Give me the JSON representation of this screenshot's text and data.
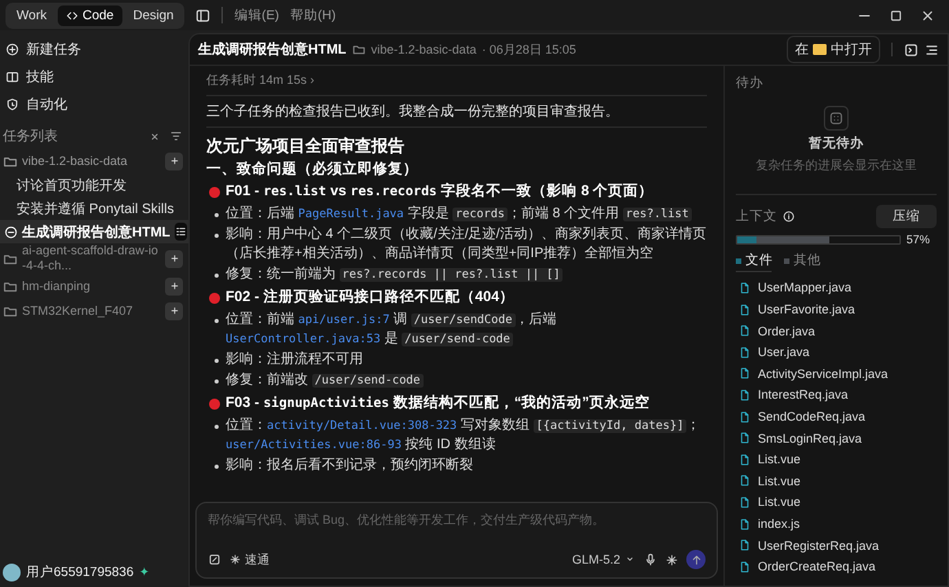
{
  "topbar": {
    "modes": [
      {
        "label": "Work",
        "kind": "plain",
        "selected": false
      },
      {
        "label": "Code",
        "kind": "code",
        "selected": true
      },
      {
        "label": "Design",
        "kind": "plain",
        "selected": false
      }
    ],
    "menus": [
      "编辑(E)",
      "帮助(H)"
    ]
  },
  "sidebar": {
    "actions": [
      {
        "label": "新建任务",
        "kind": "new"
      },
      {
        "label": "技能",
        "kind": "skills"
      },
      {
        "label": "自动化",
        "kind": "auto"
      }
    ],
    "task_list_title": "任务列表",
    "projects": [
      {
        "name": "vibe-1.2-basic-data",
        "expanded": true,
        "children": [
          {
            "label": "讨论首页功能开发",
            "selected": false
          },
          {
            "label": "安装并遵循 Ponytail Skills",
            "selected": false
          },
          {
            "label": "生成调研报告创意HTML",
            "selected": true
          }
        ]
      },
      {
        "name": "ai-agent-scaffold-draw-io-4-4-ch...",
        "expanded": false
      },
      {
        "name": "hm-dianping",
        "expanded": false
      },
      {
        "name": "STM32Kernel_F407",
        "expanded": false
      }
    ],
    "user": {
      "name": "用户65591795836",
      "badge": "✦"
    }
  },
  "chat": {
    "title": "生成调研报告创意HTML",
    "project": "vibe-1.2-basic-data",
    "date": "· 06月28日 15:05",
    "duration": "任务耗时 14m 15s",
    "duration_caret": "›",
    "message": "三个子任务的检查报告已收到。我整合成一份完整的项目审查报告。",
    "report_title": "次元广场项目全面审查报告",
    "sections": [
      {
        "heading": "一、致命问题（必须立即修复）",
        "issues": [
          {
            "title": [
              {
                "kind": "text",
                "text": "F01 - "
              },
              {
                "kind": "code",
                "text": "res.list"
              },
              {
                "kind": "text",
                "text": " vs "
              },
              {
                "kind": "code",
                "text": "res.records"
              },
              {
                "kind": "text",
                "text": " 字段名不一致（影响 8 个页面）"
              }
            ],
            "bullets": [
              [
                {
                  "kind": "text",
                  "text": "位置：后端 "
                },
                {
                  "kind": "link",
                  "text": "PageResult.java"
                },
                {
                  "kind": "text",
                  "text": " 字段是 "
                },
                {
                  "kind": "chip",
                  "text": "records"
                },
                {
                  "kind": "text",
                  "text": "；前端 8 个文件用 "
                },
                {
                  "kind": "chip",
                  "text": "res?.list"
                }
              ],
              [
                {
                  "kind": "text",
                  "text": "影响：用户中心 4 个二级页（收藏/关注/足迹/活动）、商家列表页、商家详情页（店长推荐+相关活动）、商品详情页（同类型+同IP推荐）全部恒为空"
                }
              ],
              [
                {
                  "kind": "text",
                  "text": "修复：统一前端为 "
                },
                {
                  "kind": "chip",
                  "text": "res?.records || res?.list || []"
                }
              ]
            ]
          },
          {
            "title": [
              {
                "kind": "text",
                "text": "F02 - 注册页验证码接口路径不匹配（404）"
              }
            ],
            "bullets": [
              [
                {
                  "kind": "text",
                  "text": "位置：前端 "
                },
                {
                  "kind": "link",
                  "text": "api/user.js:7"
                },
                {
                  "kind": "text",
                  "text": " 调 "
                },
                {
                  "kind": "chip",
                  "text": "/user/sendCode"
                },
                {
                  "kind": "text",
                  "text": "，后端 "
                },
                {
                  "kind": "link",
                  "text": "UserController.java:53"
                },
                {
                  "kind": "text",
                  "text": " 是 "
                },
                {
                  "kind": "chip",
                  "text": "/user/send-code"
                }
              ],
              [
                {
                  "kind": "text",
                  "text": "影响：注册流程不可用"
                }
              ],
              [
                {
                  "kind": "text",
                  "text": "修复：前端改 "
                },
                {
                  "kind": "chip",
                  "text": "/user/send-code"
                }
              ]
            ]
          },
          {
            "title": [
              {
                "kind": "text",
                "text": "F03 - "
              },
              {
                "kind": "code",
                "text": "signupActivities"
              },
              {
                "kind": "text",
                "text": " 数据结构不匹配，“我的活动”页永远空"
              }
            ],
            "bullets": [
              [
                {
                  "kind": "text",
                  "text": "位置："
                },
                {
                  "kind": "link",
                  "text": "activity/Detail.vue:308-323"
                },
                {
                  "kind": "text",
                  "text": " 写对象数组 "
                },
                {
                  "kind": "chip",
                  "text": "[{activityId, dates}]"
                },
                {
                  "kind": "text",
                  "text": "；"
                },
                {
                  "kind": "link",
                  "text": "user/Activities.vue:86-93"
                },
                {
                  "kind": "text",
                  "text": " 按纯 ID 数组读"
                }
              ],
              [
                {
                  "kind": "text",
                  "text": "影响：报名后看不到记录，预约闭环断裂"
                }
              ]
            ]
          }
        ]
      }
    ],
    "input": {
      "placeholder": "帮你编写代码、调试 Bug、优化性能等开发工作，交付生产级代码产物。",
      "mode": "速通",
      "model": "GLM-5.2"
    }
  },
  "panel": {
    "open_in": {
      "before": "在",
      "after": "中打开"
    },
    "todo": {
      "title": "待办",
      "empty_title": "暂无待办",
      "empty_hint": "复杂任务的进展会显示在这里"
    },
    "context": {
      "title": "上下文",
      "compress": "压缩",
      "percent": "57%",
      "level": 0.57,
      "segments": [
        {
          "label": "文件",
          "level": 0.12,
          "color": "#1e6f80",
          "selected": true
        },
        {
          "label": "其他",
          "color": "#4a4d52",
          "selected": false
        }
      ]
    },
    "files": [
      "UserMapper.java",
      "UserFavorite.java",
      "Order.java",
      "User.java",
      "ActivityServiceImpl.java",
      "InterestReq.java",
      "SendCodeReq.java",
      "SmsLoginReq.java",
      "List.vue",
      "List.vue",
      "List.vue",
      "index.js",
      "UserRegisterReq.java",
      "OrderCreateReq.java"
    ]
  }
}
